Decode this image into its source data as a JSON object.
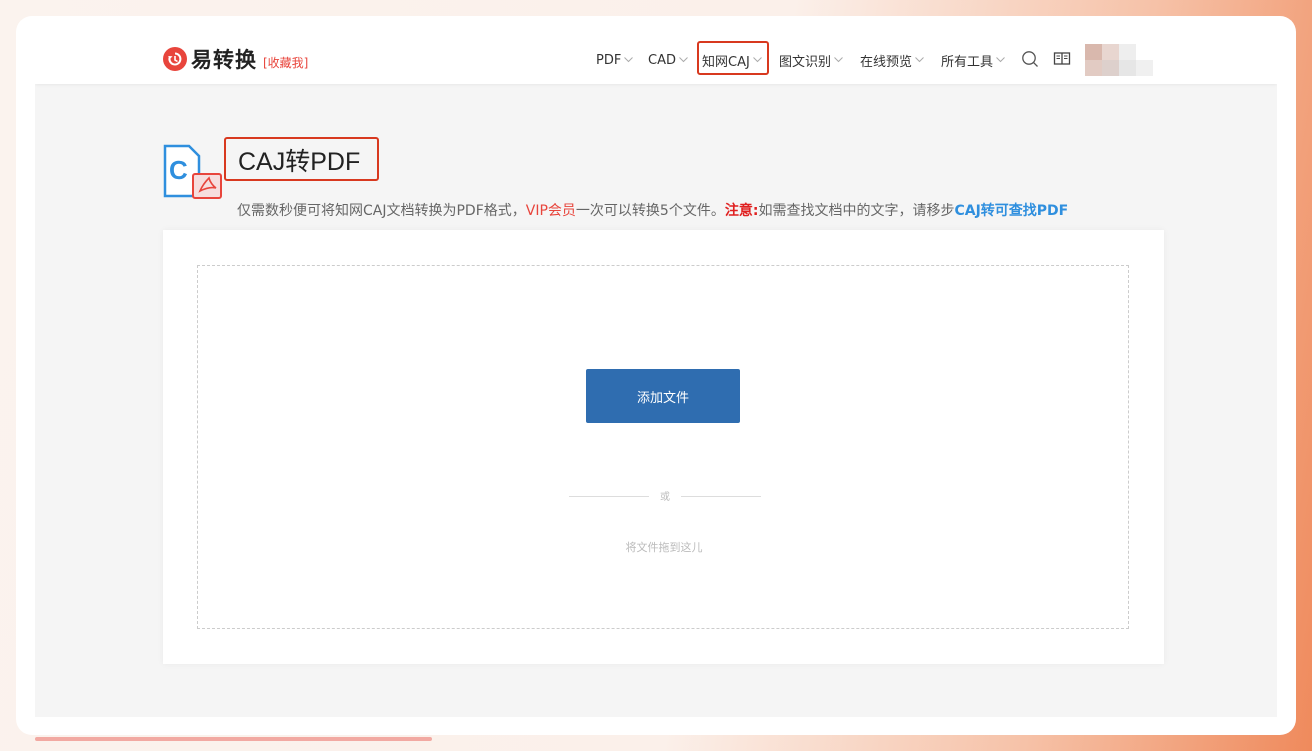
{
  "header": {
    "logo_text": "易转换",
    "favorite_label": "[收藏我]",
    "nav": [
      {
        "label": "PDF"
      },
      {
        "label": "CAD"
      },
      {
        "label": "知网CAJ"
      },
      {
        "label": "图文识别"
      },
      {
        "label": "在线预览"
      },
      {
        "label": "所有工具"
      }
    ],
    "search_icon": "search-icon",
    "book_icon": "book-icon"
  },
  "main": {
    "title": "CAJ转PDF",
    "desc": {
      "part1": "仅需数秒便可将知网CAJ文档转换为PDF格式，",
      "vip": "VIP会员",
      "part2": "一次可以转换5个文件。",
      "note": "注意:",
      "part3": "如需查找文档中的文字，请移步",
      "link": "CAJ转可查找PDF"
    }
  },
  "upload": {
    "add_button": "添加文件",
    "or_text": "或",
    "drag_text": "将文件拖到这儿"
  },
  "colors": {
    "brand_red": "#e8453c",
    "button_blue": "#2f6db0",
    "link_blue": "#2f8fde",
    "highlight_red": "#d8391f"
  }
}
